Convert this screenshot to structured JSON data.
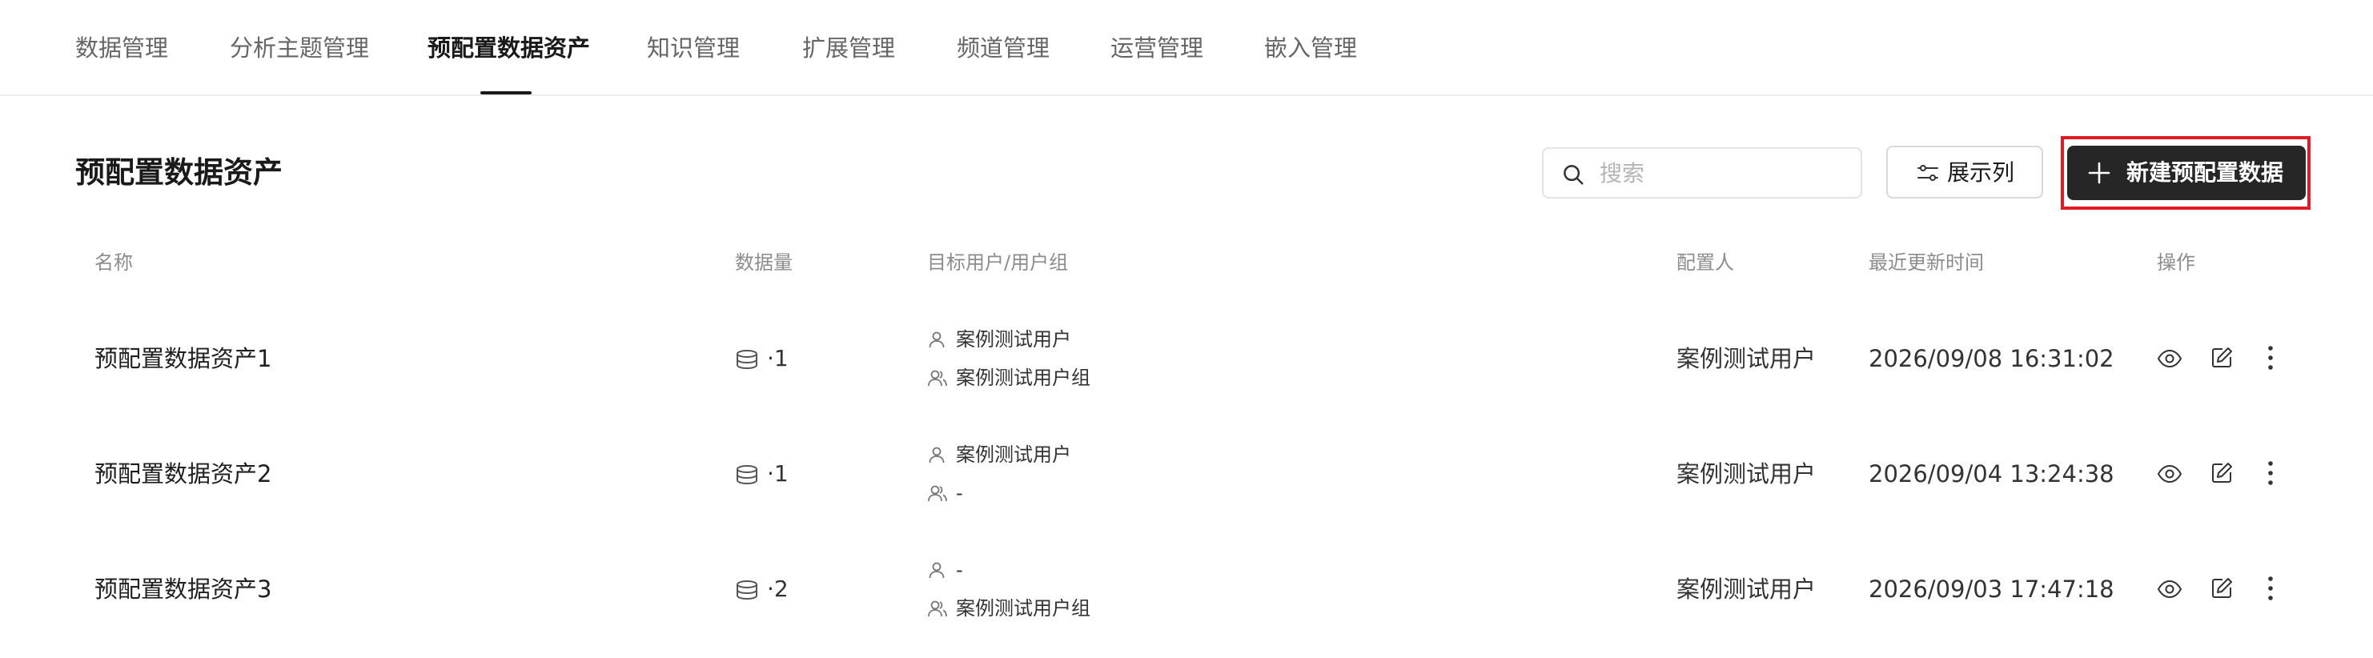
{
  "nav": {
    "tabs": [
      {
        "label": "数据管理"
      },
      {
        "label": "分析主题管理"
      },
      {
        "label": "预配置数据资产"
      },
      {
        "label": "知识管理"
      },
      {
        "label": "扩展管理"
      },
      {
        "label": "频道管理"
      },
      {
        "label": "运营管理"
      },
      {
        "label": "嵌入管理"
      }
    ],
    "active_tab": "预配置数据资产"
  },
  "header": {
    "title": "预配置数据资产",
    "search_placeholder": "搜索",
    "columns_button": "展示列",
    "create_button": "新建预配置数据"
  },
  "table": {
    "columns": [
      "名称",
      "数据量",
      "目标用户/用户组",
      "配置人",
      "最近更新时间",
      "操作"
    ],
    "rows": [
      {
        "name": "预配置数据资产1",
        "volume": "·1",
        "user": "案例测试用户",
        "group": "案例测试用户组",
        "configurer": "案例测试用户",
        "updated": "2026/09/08 16:31:02"
      },
      {
        "name": "预配置数据资产2",
        "volume": "·1",
        "user": "案例测试用户",
        "group": "-",
        "configurer": "案例测试用户",
        "updated": "2026/09/04 13:24:38"
      },
      {
        "name": "预配置数据资产3",
        "volume": "·2",
        "user": "-",
        "group": "案例测试用户组",
        "configurer": "案例测试用户",
        "updated": "2026/09/03 17:47:18"
      }
    ],
    "action_icons": [
      "eye-icon",
      "edit-icon",
      "more-vertical-icon"
    ]
  },
  "colors": {
    "primary_button": "#262626",
    "highlight_border": "#e01b24",
    "active_tab": "#1a1a1a",
    "muted_text": "#8c8c8c"
  }
}
